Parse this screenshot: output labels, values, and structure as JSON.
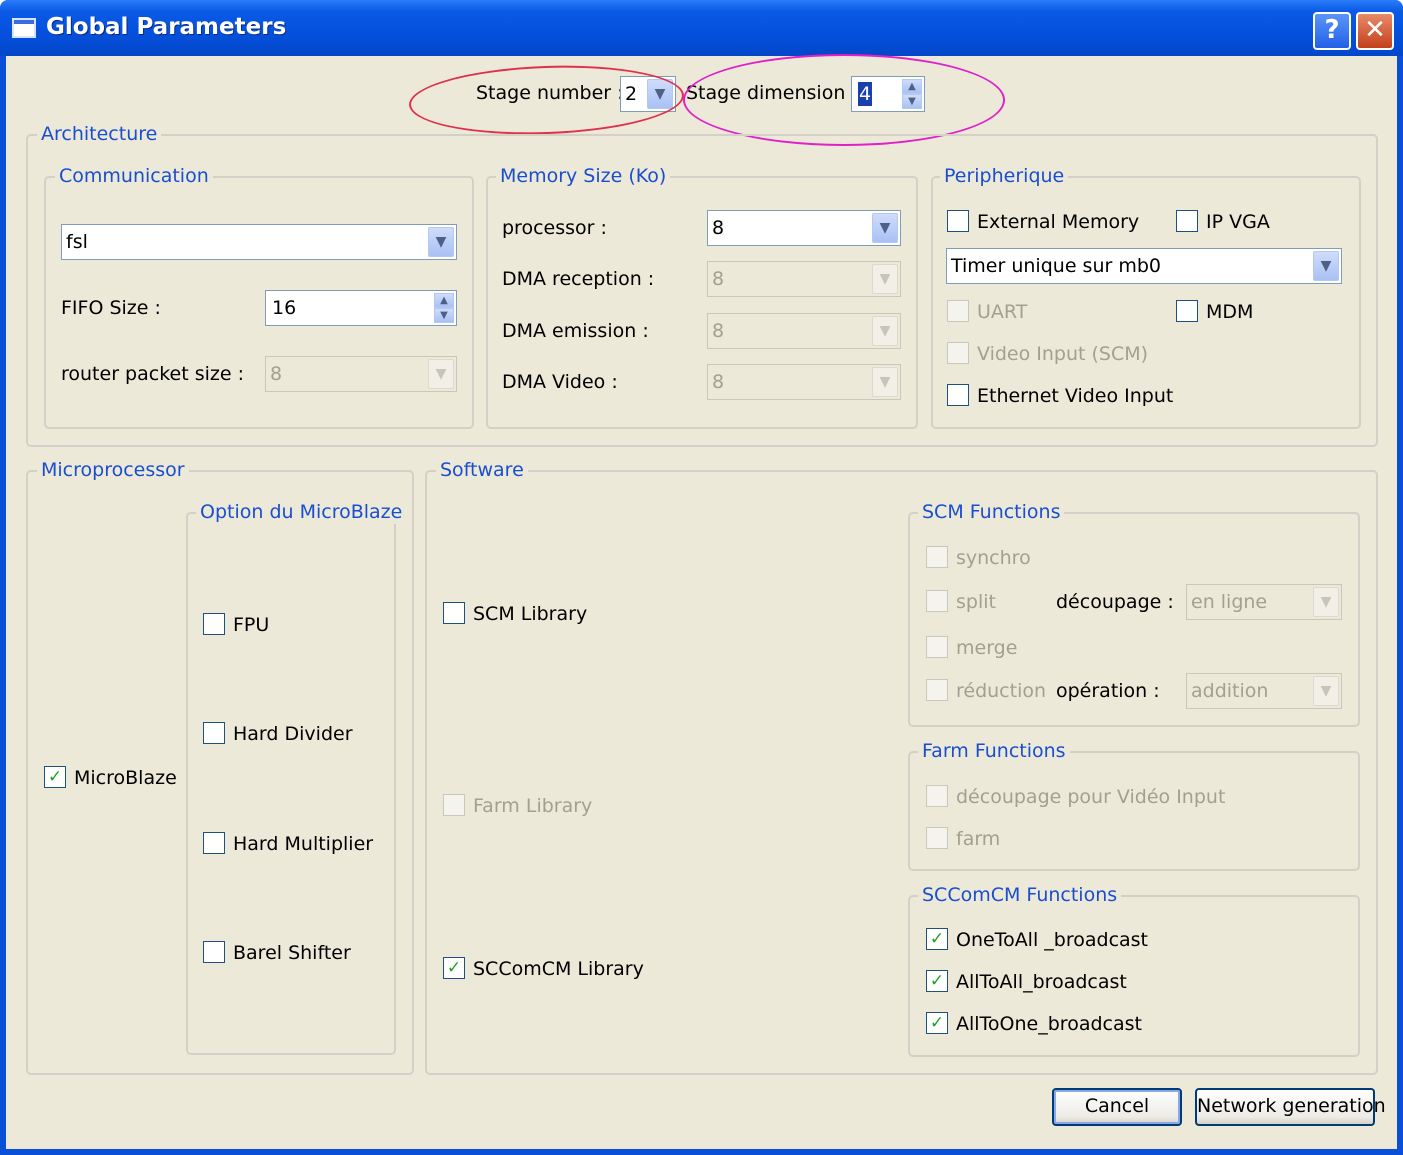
{
  "window": {
    "title": "Global Parameters",
    "help_glyph": "?",
    "close_glyph": "✕"
  },
  "top": {
    "stage_number_label": "Stage number :",
    "stage_number_value": "2",
    "stage_dimension_label": "Stage dimension :",
    "stage_dimension_value": "4"
  },
  "architecture": {
    "title": "Architecture",
    "communication": {
      "title": "Communication",
      "protocol_value": "fsl",
      "fifo_size_label": "FIFO Size :",
      "fifo_size_value": "16",
      "router_packet_size_label": "router packet size :",
      "router_packet_size_value": "8"
    },
    "memory": {
      "title": "Memory Size (Ko)",
      "processor_label": "processor :",
      "processor_value": "8",
      "dma_reception_label": "DMA reception :",
      "dma_reception_value": "8",
      "dma_emission_label": "DMA emission :",
      "dma_emission_value": "8",
      "dma_video_label": "DMA Video :",
      "dma_video_value": "8"
    },
    "peripherique": {
      "title": "Peripherique",
      "external_memory": "External Memory",
      "ip_vga": "IP VGA",
      "timer_value": "Timer unique sur mb0",
      "uart": "UART",
      "mdm": "MDM",
      "video_input": "Video Input (SCM)",
      "ethernet_video_input": "Ethernet Video Input"
    }
  },
  "microprocessor": {
    "title": "Microprocessor",
    "microblaze": "MicroBlaze",
    "options_title": "Option du MicroBlaze",
    "fpu": "FPU",
    "hard_divider": "Hard Divider",
    "hard_multiplier": "Hard Multiplier",
    "barel_shifter": "Barel Shifter"
  },
  "software": {
    "title": "Software",
    "scm_library": "SCM Library",
    "farm_library": "Farm Library",
    "sccomcm_library": "SCComCM Library",
    "scm_functions": {
      "title": "SCM Functions",
      "synchro": "synchro",
      "split": "split",
      "decoupage_label": "découpage :",
      "decoupage_value": "en ligne",
      "merge": "merge",
      "reduction": "réduction",
      "operation_label": "opération :",
      "operation_value": "addition"
    },
    "farm_functions": {
      "title": "Farm Functions",
      "decoupage_video": "découpage pour Vidéo Input",
      "farm": "farm"
    },
    "sccomcm_functions": {
      "title": "SCComCM Functions",
      "one_to_all": "OneToAll _broadcast",
      "all_to_all": "AllToAll_broadcast",
      "all_to_one": "AllToOne_broadcast"
    }
  },
  "buttons": {
    "cancel": "Cancel",
    "network_generation": "Network generation"
  },
  "glyphs": {
    "check": "✓",
    "arrow_down": "▼",
    "arrow_up": "▲"
  },
  "colors": {
    "legend": "#1a4ed0",
    "ellipse_red": "#e0304a",
    "ellipse_magenta": "#e020c8",
    "check": "#21a121"
  }
}
